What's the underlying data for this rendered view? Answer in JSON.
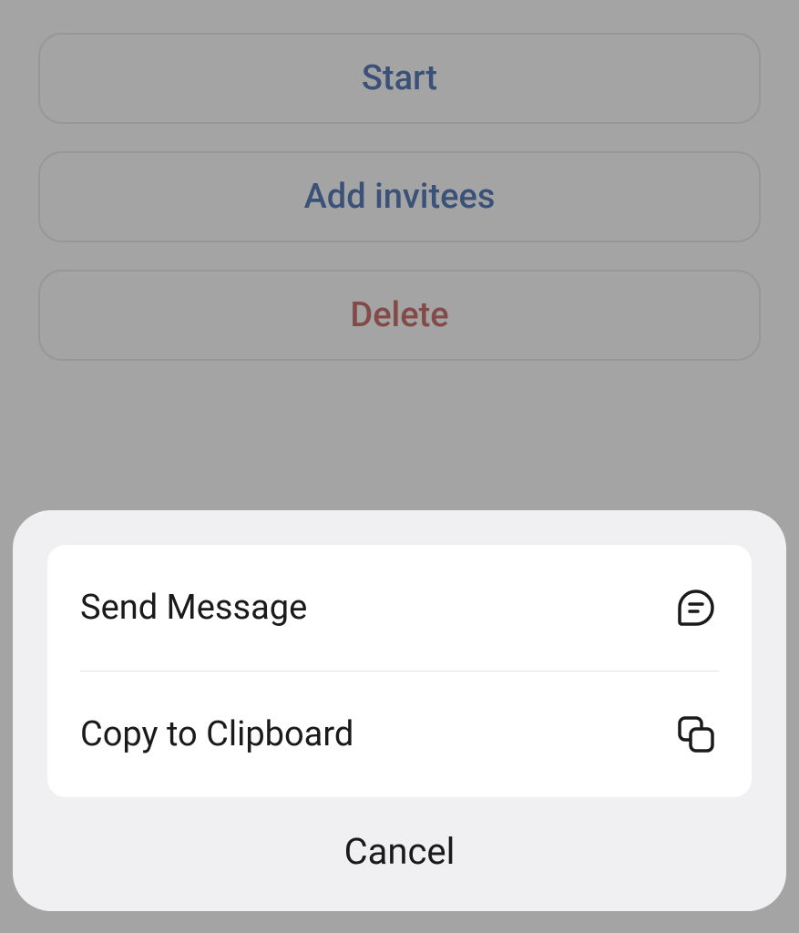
{
  "background": {
    "start_label": "Start",
    "add_invitees_label": "Add invitees",
    "delete_label": "Delete"
  },
  "action_sheet": {
    "send_message_label": "Send Message",
    "copy_clipboard_label": "Copy to Clipboard",
    "cancel_label": "Cancel"
  },
  "colors": {
    "primary_button_text": "#0a3d91",
    "destructive_button_text": "#a82a25",
    "sheet_bg": "#f0f0f2",
    "option_bg": "#ffffff",
    "text": "#1a1a1a"
  }
}
